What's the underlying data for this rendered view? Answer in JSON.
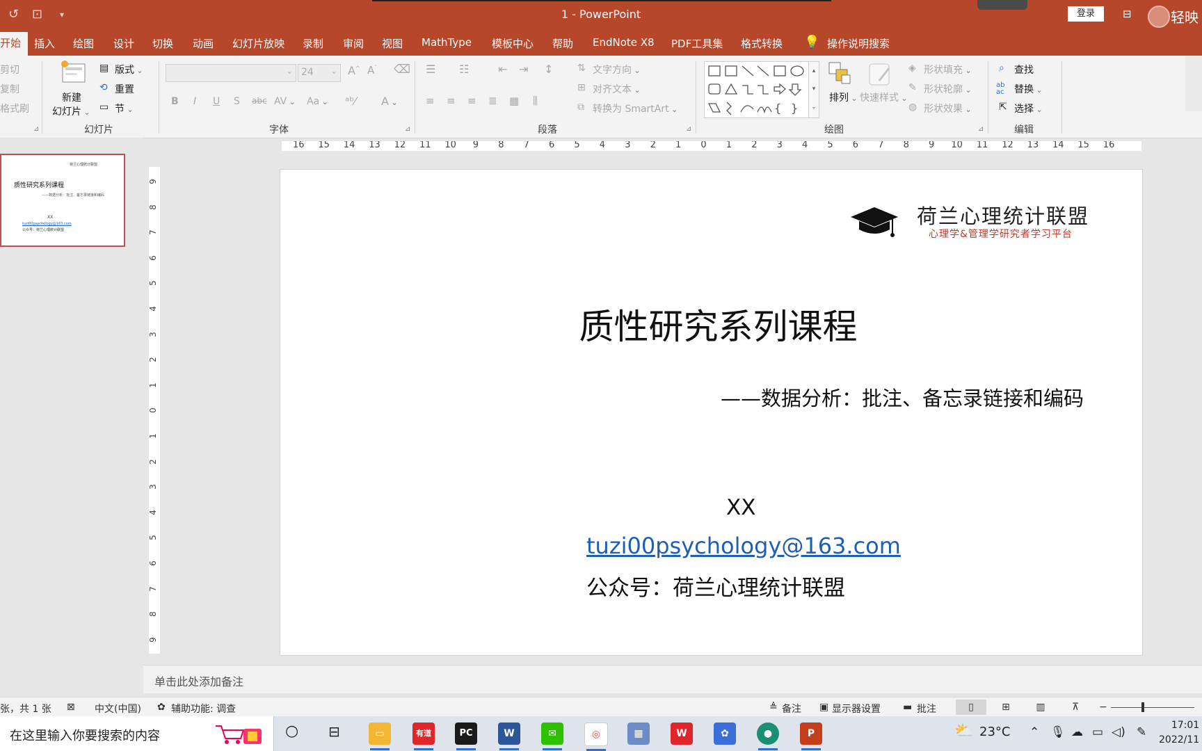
{
  "titlebar": {
    "title": "1  -  PowerPoint",
    "login": "登录",
    "user": "轻映"
  },
  "menu": {
    "tabs": [
      "开始",
      "插入",
      "绘图",
      "设计",
      "切换",
      "动画",
      "幻灯片放映",
      "录制",
      "审阅",
      "视图",
      "MathType",
      "模板中心",
      "帮助",
      "EndNote X8",
      "PDF工具集",
      "格式转换"
    ],
    "tellme": "操作说明搜索"
  },
  "ribbon": {
    "clipboard": {
      "cut": "剪切",
      "copy": "复制",
      "format_painter": "格式刷"
    },
    "slides": {
      "new_slide_line1": "新建",
      "new_slide_line2": "幻灯片",
      "layout": "版式",
      "reset": "重置",
      "section": "节",
      "group_label": "幻灯片"
    },
    "font": {
      "font_name": "",
      "font_size": "24",
      "group_label": "字体",
      "bold": "B",
      "italic": "I",
      "underline": "U",
      "shadow": "S",
      "strike": "abc",
      "spacing": "AV",
      "case": "Aa",
      "color": "A"
    },
    "paragraph": {
      "text_direction": "文字方向",
      "align_text": "对齐文本",
      "smartart": "转换为 SmartArt",
      "group_label": "段落"
    },
    "drawing": {
      "arrange": "排列",
      "quick_styles": "快速样式",
      "shape_fill": "形状填充",
      "shape_outline": "形状轮廓",
      "shape_effects": "形状效果",
      "group_label": "绘图"
    },
    "editing": {
      "find": "查找",
      "replace": "替换",
      "select": "选择",
      "group_label": "编辑"
    }
  },
  "ruler": {
    "horizontal": [
      "16",
      "15",
      "14",
      "13",
      "12",
      "11",
      "10",
      "9",
      "8",
      "7",
      "6",
      "5",
      "4",
      "3",
      "2",
      "1",
      "0",
      "1",
      "2",
      "3",
      "4",
      "5",
      "6",
      "7",
      "8",
      "9",
      "10",
      "11",
      "12",
      "13",
      "14",
      "15",
      "16"
    ],
    "vertical": [
      "9",
      "8",
      "7",
      "6",
      "5",
      "4",
      "3",
      "2",
      "1",
      "0",
      "1",
      "2",
      "3",
      "4",
      "5",
      "6",
      "7",
      "8",
      "9"
    ]
  },
  "slide": {
    "logo_title": "荷兰心理统计联盟",
    "logo_subtitle": "心理学&管理学研究者学习平台",
    "title": "质性研究系列课程",
    "subtitle": "——数据分析：批注、备忘录链接和编码",
    "author": "XX",
    "email": "tuzi00psychology@163.com",
    "wechat": "公众号：荷兰心理统计联盟"
  },
  "notes": {
    "placeholder": "单击此处添加备注"
  },
  "statusbar": {
    "slide_count": "张，共 1 张",
    "language": "中文(中国)",
    "accessibility": "辅助功能: 调查",
    "notes": "备注",
    "display_settings": "显示器设置",
    "comments": "批注"
  },
  "taskbar": {
    "search_placeholder": "在这里输入你要搜索的内容",
    "youdao": "有道",
    "pycharm": "PC",
    "word": "W",
    "weather": "23°C",
    "time": "17:01",
    "date": "2022/11"
  },
  "colors": {
    "accent": "#b7472a",
    "link": "#1f5fb3",
    "logo_red": "#c0392b"
  }
}
